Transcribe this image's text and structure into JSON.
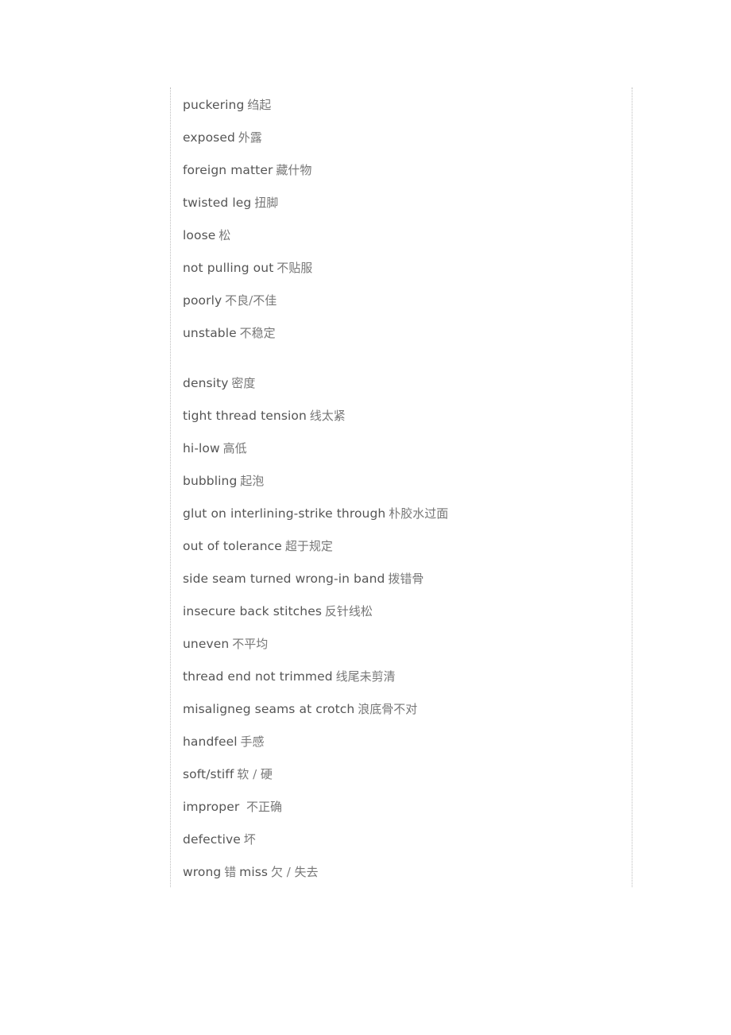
{
  "glossary": {
    "entries": [
      {
        "en": "puckering",
        "zh": "绉起"
      },
      {
        "en": "exposed",
        "zh": "外露"
      },
      {
        "en": "foreign matter",
        "zh": "藏什物"
      },
      {
        "en": "twisted leg",
        "zh": "扭脚"
      },
      {
        "en": "loose",
        "zh": "松"
      },
      {
        "en": "not pulling out",
        "zh": "不贴服"
      },
      {
        "en": "poorly",
        "zh": "不良/不佳"
      },
      {
        "en": "unstable",
        "zh": "不稳定"
      },
      {
        "en": "density",
        "zh": "密度"
      },
      {
        "en": "tight thread tension",
        "zh": "线太紧"
      },
      {
        "en": "hi-low",
        "zh": "高低"
      },
      {
        "en": "bubbling",
        "zh": "起泡"
      },
      {
        "en": "glut on interlining-strike through",
        "zh": "朴胶水过面"
      },
      {
        "en": "out of tolerance",
        "zh": "超于规定"
      },
      {
        "en": "side seam turned wrong-in band",
        "zh": "拨错骨"
      },
      {
        "en": "insecure back stitches",
        "zh": "反针线松"
      },
      {
        "en": "uneven",
        "zh": "不平均"
      },
      {
        "en": "thread end not trimmed",
        "zh": "线尾未剪清"
      },
      {
        "en": "misaligneg seams at crotch",
        "zh": "浪底骨不对"
      },
      {
        "en": "handfeel",
        "zh": "手感"
      },
      {
        "en": "soft/stiff",
        "zh": "软 / 硬"
      },
      {
        "en": "improper",
        "zh": " 不正确"
      },
      {
        "en": "defective",
        "zh": "坏"
      },
      {
        "en": "wrong",
        "zh": "错",
        "en2": "miss",
        "zh2": "欠 / 失去"
      }
    ]
  }
}
